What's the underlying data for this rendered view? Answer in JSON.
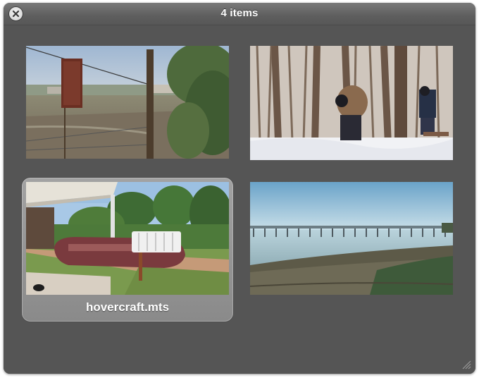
{
  "window": {
    "title": "4 items",
    "close_icon": "close-icon",
    "resize_icon": "resize-grip-icon"
  },
  "items": [
    {
      "subject": "fence with sign overlooking hills",
      "selected": false
    },
    {
      "subject": "people working in snowy woods",
      "selected": false
    },
    {
      "subject": "hovercraft under canopy with palm trees",
      "selected": true,
      "caption": "hovercraft.mts"
    },
    {
      "subject": "pier over water with rocky shore",
      "selected": false
    }
  ],
  "colors": {
    "window_bg": "#555555",
    "selection_bg": "#9a9a9a",
    "title_text": "#ffffff"
  }
}
